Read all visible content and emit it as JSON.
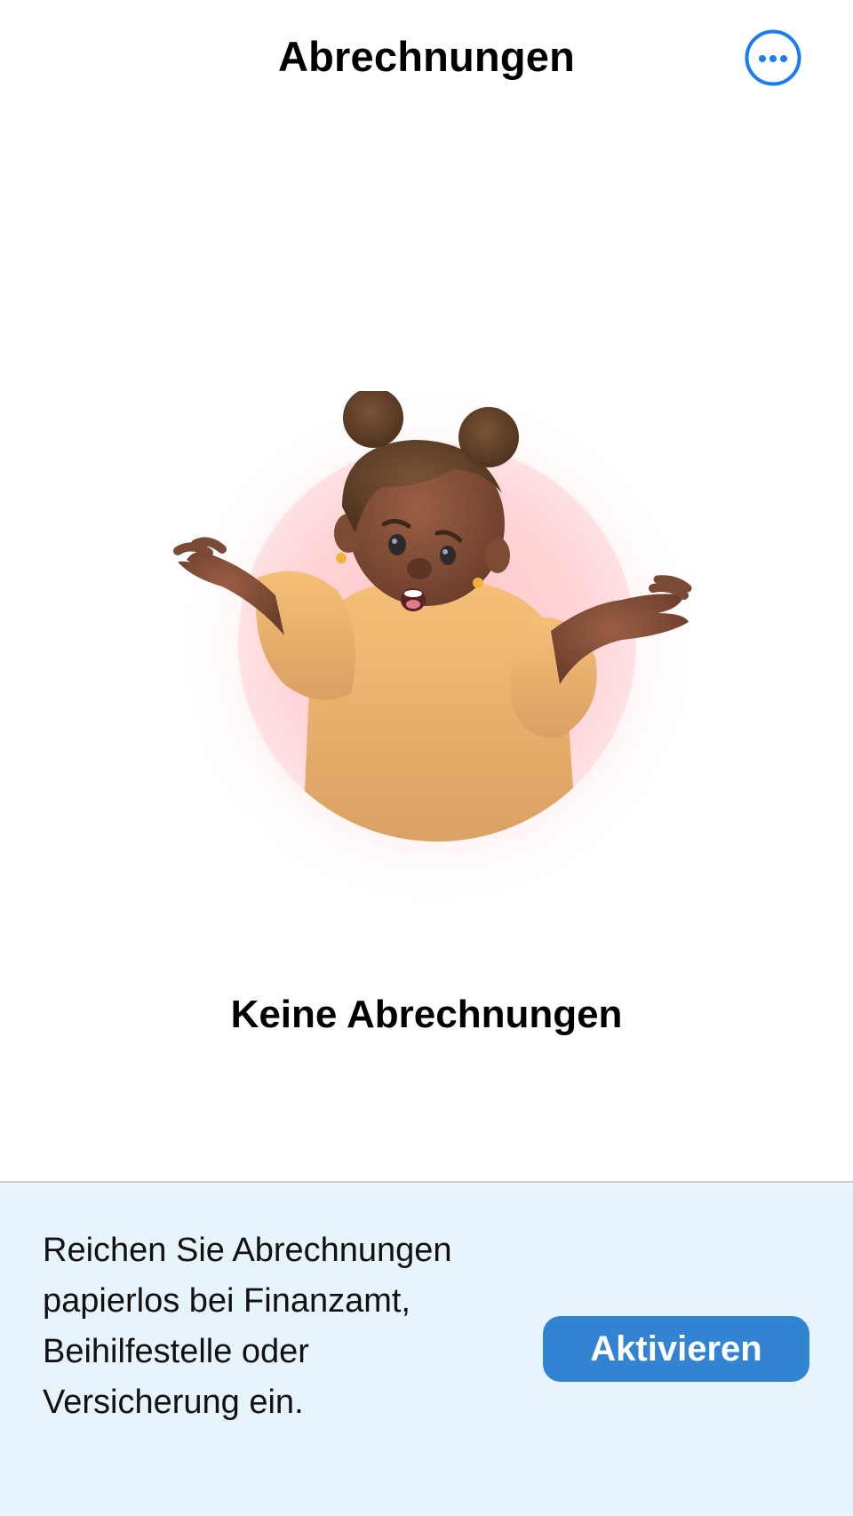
{
  "nav": {
    "title": "Abrechnungen",
    "more_icon": "ellipsis-circle-icon"
  },
  "illustration": {
    "icon": "shrugging-person-illustration",
    "circle_color": "#ffd0d4",
    "shirt_color": "#f0b56a"
  },
  "empty_state": {
    "title": "Keine Abrechnungen"
  },
  "promo": {
    "text": "Reichen Sie Abrechnungen papierlos bei Finanzamt, Beihilfestelle oder Versicherung ein.",
    "button_label": "Aktivieren"
  },
  "colors": {
    "accent": "#1a7cf2",
    "button": "#3383d3",
    "banner_background": "#e8f4fc"
  }
}
